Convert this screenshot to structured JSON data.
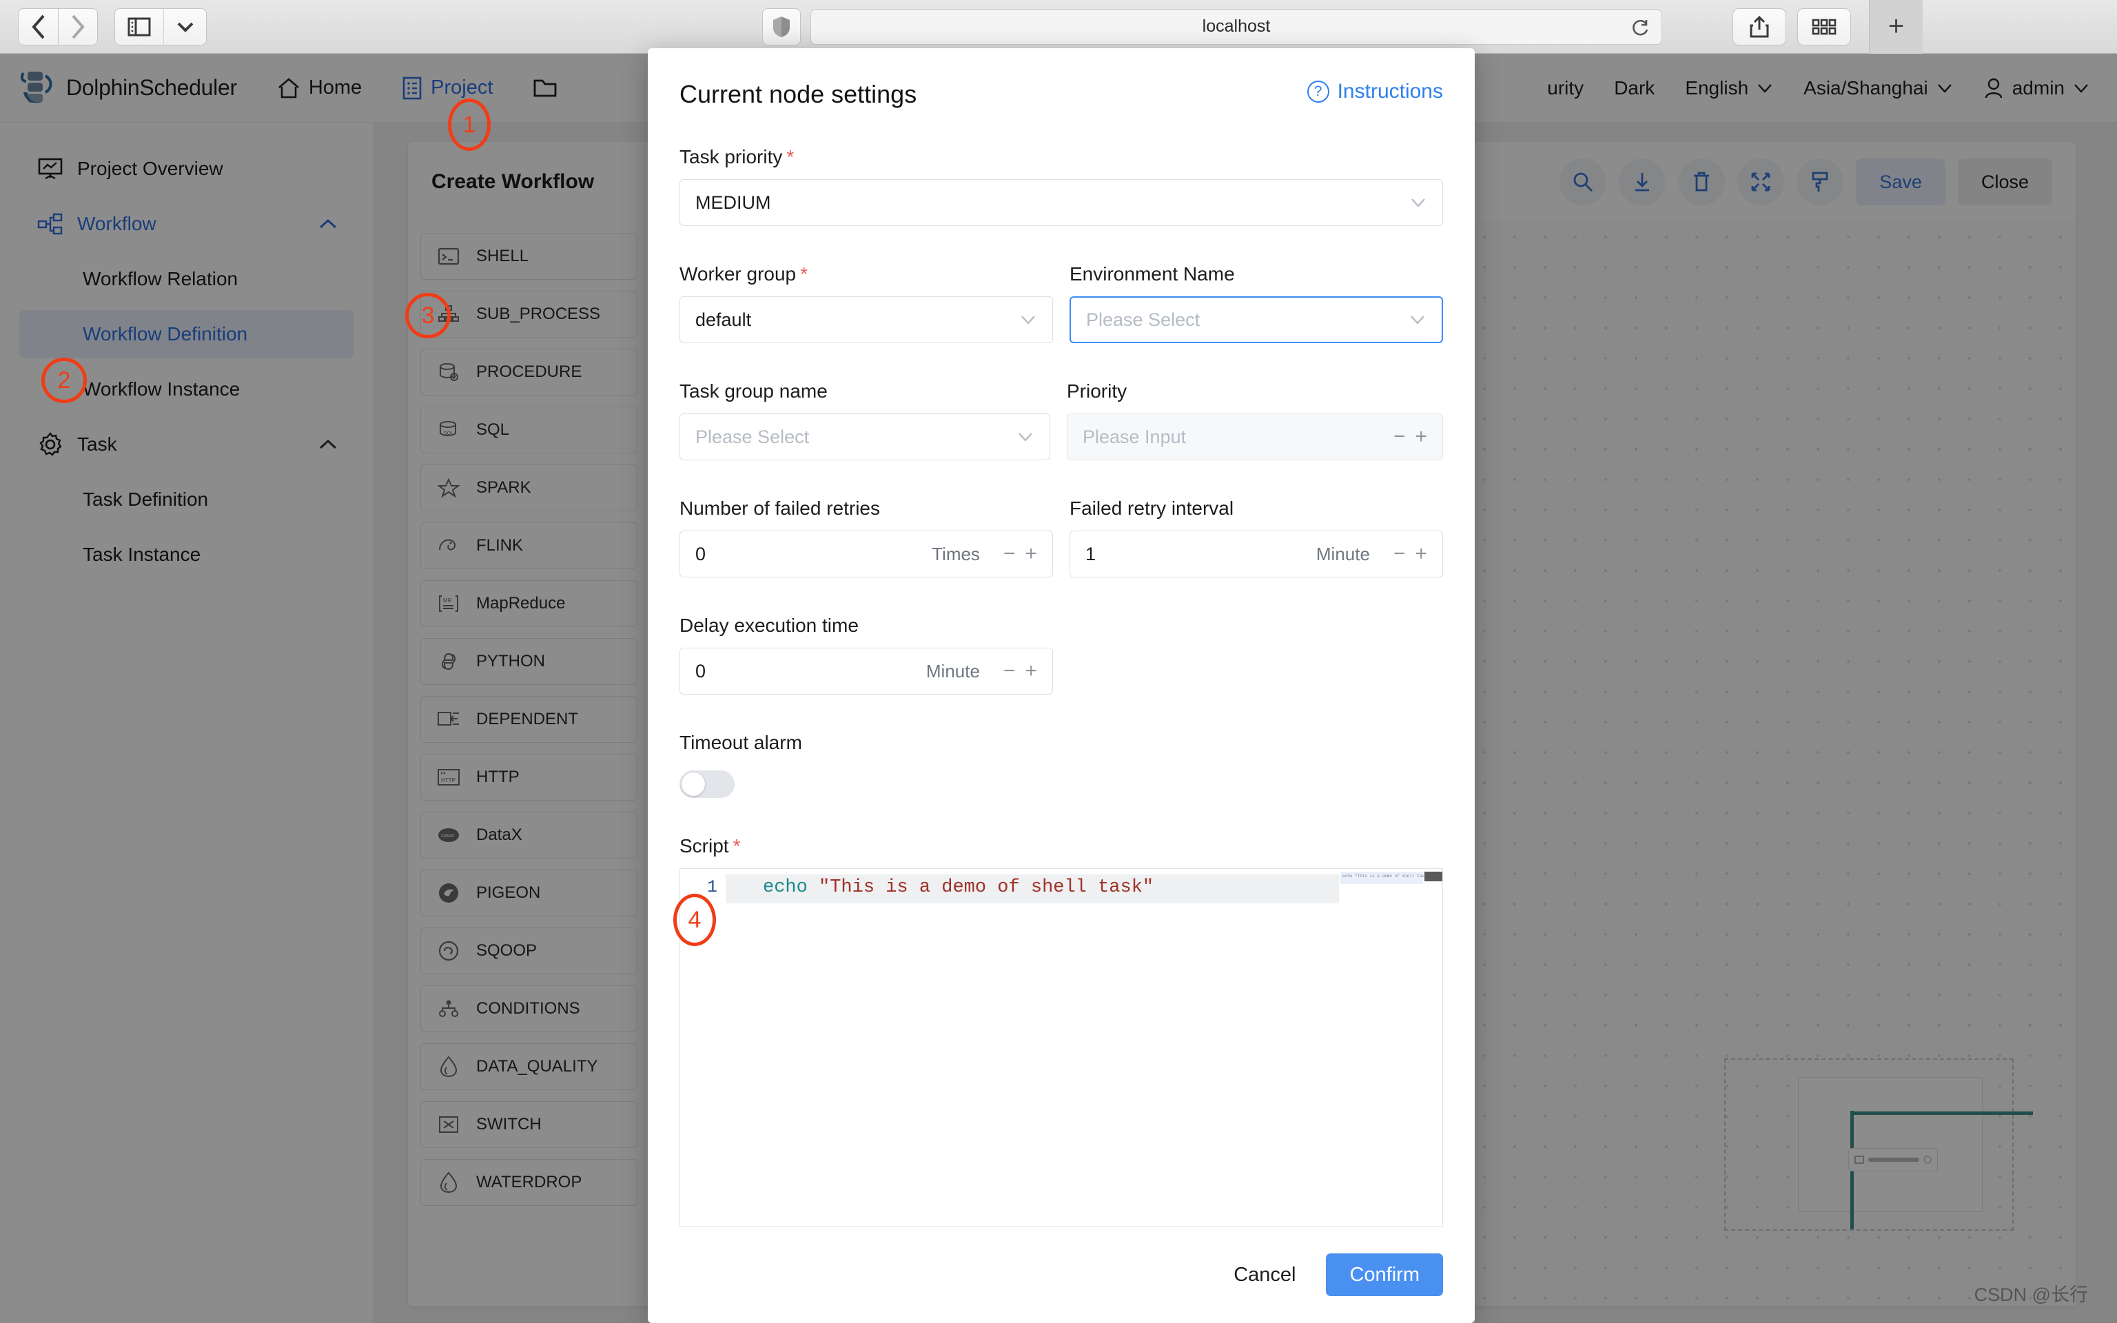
{
  "browser": {
    "url": "localhost",
    "back_label": "Back",
    "forward_label": "Forward",
    "sidebar_label": "Sidebar",
    "shield_label": "Privacy Report",
    "share_label": "Share",
    "tab_overview_label": "Tab Overview",
    "new_tab_label": "+"
  },
  "header": {
    "brand": "DolphinScheduler",
    "nav": [
      {
        "label": "Home",
        "icon": "home-icon",
        "active": false
      },
      {
        "label": "Project",
        "icon": "project-icon",
        "active": true
      },
      {
        "label": "",
        "icon": "folder-icon",
        "active": false
      }
    ],
    "security_label": "urity",
    "theme_label": "Dark",
    "language_label": "English",
    "timezone_label": "Asia/Shanghai",
    "user_label": "admin"
  },
  "sidebar": {
    "items": [
      {
        "label": "Project Overview",
        "type": "top",
        "icon": "overview-icon",
        "active": false
      },
      {
        "label": "Workflow",
        "type": "group",
        "icon": "workflow-icon",
        "active": true,
        "expanded": true
      },
      {
        "label": "Workflow Relation",
        "type": "sub",
        "active": false
      },
      {
        "label": "Workflow Definition",
        "type": "sub",
        "active": true
      },
      {
        "label": "Workflow Instance",
        "type": "sub",
        "active": false
      },
      {
        "label": "Task",
        "type": "group",
        "icon": "gear-icon",
        "active": false,
        "expanded": true
      },
      {
        "label": "Task Definition",
        "type": "sub",
        "active": false
      },
      {
        "label": "Task Instance",
        "type": "sub",
        "active": false
      }
    ]
  },
  "content": {
    "card_title": "Create Workflow",
    "toolbar": {
      "icons": [
        "search-icon",
        "download-icon",
        "trash-icon",
        "fullscreen-icon",
        "format-icon"
      ],
      "save_label": "Save",
      "close_label": "Close"
    },
    "task_types": [
      {
        "label": "SHELL",
        "icon": "shell-icon"
      },
      {
        "label": "SUB_PROCESS",
        "icon": "subprocess-icon"
      },
      {
        "label": "PROCEDURE",
        "icon": "procedure-icon"
      },
      {
        "label": "SQL",
        "icon": "sql-icon"
      },
      {
        "label": "SPARK",
        "icon": "spark-icon"
      },
      {
        "label": "FLINK",
        "icon": "flink-icon"
      },
      {
        "label": "MapReduce",
        "icon": "mapreduce-icon"
      },
      {
        "label": "PYTHON",
        "icon": "python-icon"
      },
      {
        "label": "DEPENDENT",
        "icon": "dependent-icon"
      },
      {
        "label": "HTTP",
        "icon": "http-icon"
      },
      {
        "label": "DataX",
        "icon": "datax-icon"
      },
      {
        "label": "PIGEON",
        "icon": "pigeon-icon"
      },
      {
        "label": "SQOOP",
        "icon": "sqoop-icon"
      },
      {
        "label": "CONDITIONS",
        "icon": "conditions-icon"
      },
      {
        "label": "DATA_QUALITY",
        "icon": "dataquality-icon"
      },
      {
        "label": "SWITCH",
        "icon": "switch-icon"
      },
      {
        "label": "WATERDROP",
        "icon": "waterdrop-icon"
      }
    ],
    "watermark": "CSDN @长行"
  },
  "modal": {
    "title": "Current node settings",
    "instructions_label": "Instructions",
    "fields": {
      "task_priority": {
        "label": "Task priority",
        "required": true,
        "value": "MEDIUM"
      },
      "worker_group": {
        "label": "Worker group",
        "required": true,
        "value": "default"
      },
      "environment_name": {
        "label": "Environment Name",
        "required": false,
        "placeholder": "Please Select",
        "value": ""
      },
      "task_group_name": {
        "label": "Task group name",
        "required": false,
        "placeholder": "Please Select",
        "value": ""
      },
      "priority": {
        "label": "Priority",
        "required": false,
        "placeholder": "Please Input",
        "value": ""
      },
      "failed_retries": {
        "label": "Number of failed retries",
        "required": false,
        "value": "0",
        "unit": "Times"
      },
      "failed_retry_interval": {
        "label": "Failed retry interval",
        "required": false,
        "value": "1",
        "unit": "Minute"
      },
      "delay_execution_time": {
        "label": "Delay execution time",
        "required": false,
        "value": "0",
        "unit": "Minute"
      },
      "timeout_alarm": {
        "label": "Timeout alarm",
        "enabled": false
      },
      "script": {
        "label": "Script",
        "required": true,
        "line_number": "1",
        "code_cmd": "echo ",
        "code_str": "\"This is a demo of shell task\"",
        "minimap_text": "echo \"This is a demo of shell task\""
      }
    },
    "cancel_label": "Cancel",
    "confirm_label": "Confirm"
  },
  "annotations": [
    {
      "id": "1",
      "target": "project-nav"
    },
    {
      "id": "2",
      "target": "workflow-definition"
    },
    {
      "id": "3",
      "target": "shell-task-type"
    },
    {
      "id": "4",
      "target": "script-editor"
    }
  ],
  "colors": {
    "accent_blue": "#2f6fe0",
    "confirm_blue": "#4a90f0",
    "required_red": "#e8605c",
    "annotation_red": "#f03d16",
    "teal": "#3f8f8c"
  }
}
